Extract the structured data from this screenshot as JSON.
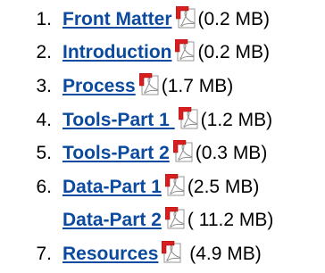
{
  "documents": [
    {
      "number": "1.",
      "title": "Front Matter",
      "size": "(0.2 MB)"
    },
    {
      "number": "2.",
      "title": "Introduction",
      "size": "(0.2 MB)"
    },
    {
      "number": "3.",
      "title": "Process",
      "size": "(1.7 MB)"
    },
    {
      "number": "4.",
      "title": "Tools-Part 1 ",
      "size": "(1.2 MB)"
    },
    {
      "number": "5.",
      "title": "Tools-Part 2",
      "size": "(0.3 MB)"
    },
    {
      "number": "6.",
      "title": "Data-Part 1",
      "size": "(2.5 MB)"
    },
    {
      "number": "",
      "title": "Data-Part 2",
      "size": "( 11.2 MB)"
    },
    {
      "number": "7.",
      "title": "Resources",
      "size": " (4.9 MB)"
    }
  ],
  "icons": {
    "pdf": "pdf-icon"
  },
  "colors": {
    "link": "#0b4a9e",
    "pdf_red": "#d81e1e",
    "text": "#000000"
  }
}
